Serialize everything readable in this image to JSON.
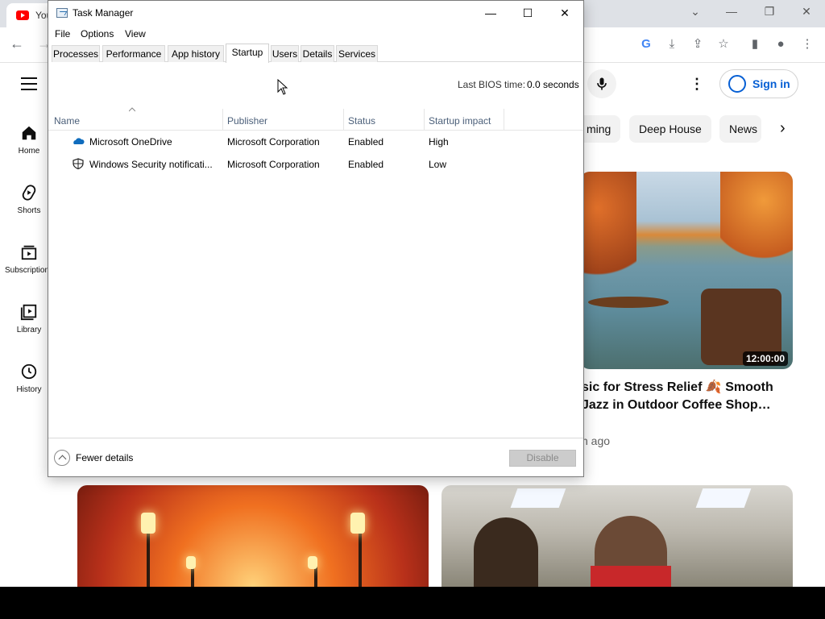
{
  "browser": {
    "tab_title": "You",
    "youtube": {
      "sidebar": [
        {
          "label": "Home",
          "icon": "home-icon"
        },
        {
          "label": "Shorts",
          "icon": "shorts-icon"
        },
        {
          "label": "Subscriptions",
          "icon": "subscriptions-icon"
        },
        {
          "label": "Library",
          "icon": "library-icon"
        },
        {
          "label": "History",
          "icon": "history-icon"
        }
      ],
      "sign_in": "Sign in",
      "chips": [
        "ming",
        "Deep House",
        "News"
      ],
      "video": {
        "duration": "12:00:00",
        "title": "sic for Stress Relief 🍂 Smooth Jazz in Outdoor Coffee Shop…",
        "meta": "h ago"
      }
    }
  },
  "task_manager": {
    "title": "Task Manager",
    "menu": [
      "File",
      "Options",
      "View"
    ],
    "tabs": [
      {
        "label": "Processes",
        "active": false
      },
      {
        "label": "Performance",
        "active": false
      },
      {
        "label": "App history",
        "active": false
      },
      {
        "label": "Startup",
        "active": true
      },
      {
        "label": "Users",
        "active": false
      },
      {
        "label": "Details",
        "active": false
      },
      {
        "label": "Services",
        "active": false
      }
    ],
    "bios_label": "Last BIOS time:",
    "bios_value": "0.0 seconds",
    "columns": [
      "Name",
      "Publisher",
      "Status",
      "Startup impact"
    ],
    "rows": [
      {
        "icon": "onedrive-cloud-icon",
        "name": "Microsoft OneDrive",
        "publisher": "Microsoft Corporation",
        "status": "Enabled",
        "impact": "High"
      },
      {
        "icon": "windows-security-shield-icon",
        "name": "Windows Security notificati...",
        "publisher": "Microsoft Corporation",
        "status": "Enabled",
        "impact": "Low"
      }
    ],
    "fewer_details": "Fewer details",
    "disable_button": "Disable",
    "accent": "#0078d4"
  }
}
